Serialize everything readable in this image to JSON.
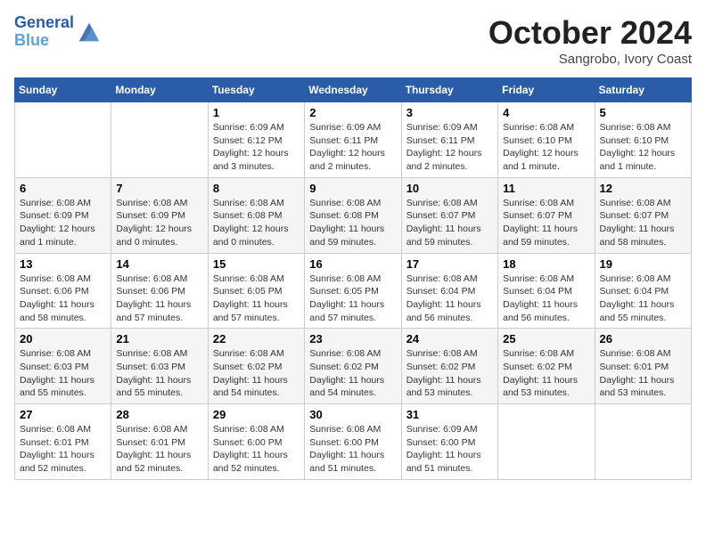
{
  "header": {
    "logo_line1": "General",
    "logo_line2": "Blue",
    "month": "October 2024",
    "location": "Sangrobo, Ivory Coast"
  },
  "weekdays": [
    "Sunday",
    "Monday",
    "Tuesday",
    "Wednesday",
    "Thursday",
    "Friday",
    "Saturday"
  ],
  "weeks": [
    [
      {
        "day": "",
        "info": ""
      },
      {
        "day": "",
        "info": ""
      },
      {
        "day": "1",
        "info": "Sunrise: 6:09 AM\nSunset: 6:12 PM\nDaylight: 12 hours and 3 minutes."
      },
      {
        "day": "2",
        "info": "Sunrise: 6:09 AM\nSunset: 6:11 PM\nDaylight: 12 hours and 2 minutes."
      },
      {
        "day": "3",
        "info": "Sunrise: 6:09 AM\nSunset: 6:11 PM\nDaylight: 12 hours and 2 minutes."
      },
      {
        "day": "4",
        "info": "Sunrise: 6:08 AM\nSunset: 6:10 PM\nDaylight: 12 hours and 1 minute."
      },
      {
        "day": "5",
        "info": "Sunrise: 6:08 AM\nSunset: 6:10 PM\nDaylight: 12 hours and 1 minute."
      }
    ],
    [
      {
        "day": "6",
        "info": "Sunrise: 6:08 AM\nSunset: 6:09 PM\nDaylight: 12 hours and 1 minute."
      },
      {
        "day": "7",
        "info": "Sunrise: 6:08 AM\nSunset: 6:09 PM\nDaylight: 12 hours and 0 minutes."
      },
      {
        "day": "8",
        "info": "Sunrise: 6:08 AM\nSunset: 6:08 PM\nDaylight: 12 hours and 0 minutes."
      },
      {
        "day": "9",
        "info": "Sunrise: 6:08 AM\nSunset: 6:08 PM\nDaylight: 11 hours and 59 minutes."
      },
      {
        "day": "10",
        "info": "Sunrise: 6:08 AM\nSunset: 6:07 PM\nDaylight: 11 hours and 59 minutes."
      },
      {
        "day": "11",
        "info": "Sunrise: 6:08 AM\nSunset: 6:07 PM\nDaylight: 11 hours and 59 minutes."
      },
      {
        "day": "12",
        "info": "Sunrise: 6:08 AM\nSunset: 6:07 PM\nDaylight: 11 hours and 58 minutes."
      }
    ],
    [
      {
        "day": "13",
        "info": "Sunrise: 6:08 AM\nSunset: 6:06 PM\nDaylight: 11 hours and 58 minutes."
      },
      {
        "day": "14",
        "info": "Sunrise: 6:08 AM\nSunset: 6:06 PM\nDaylight: 11 hours and 57 minutes."
      },
      {
        "day": "15",
        "info": "Sunrise: 6:08 AM\nSunset: 6:05 PM\nDaylight: 11 hours and 57 minutes."
      },
      {
        "day": "16",
        "info": "Sunrise: 6:08 AM\nSunset: 6:05 PM\nDaylight: 11 hours and 57 minutes."
      },
      {
        "day": "17",
        "info": "Sunrise: 6:08 AM\nSunset: 6:04 PM\nDaylight: 11 hours and 56 minutes."
      },
      {
        "day": "18",
        "info": "Sunrise: 6:08 AM\nSunset: 6:04 PM\nDaylight: 11 hours and 56 minutes."
      },
      {
        "day": "19",
        "info": "Sunrise: 6:08 AM\nSunset: 6:04 PM\nDaylight: 11 hours and 55 minutes."
      }
    ],
    [
      {
        "day": "20",
        "info": "Sunrise: 6:08 AM\nSunset: 6:03 PM\nDaylight: 11 hours and 55 minutes."
      },
      {
        "day": "21",
        "info": "Sunrise: 6:08 AM\nSunset: 6:03 PM\nDaylight: 11 hours and 55 minutes."
      },
      {
        "day": "22",
        "info": "Sunrise: 6:08 AM\nSunset: 6:02 PM\nDaylight: 11 hours and 54 minutes."
      },
      {
        "day": "23",
        "info": "Sunrise: 6:08 AM\nSunset: 6:02 PM\nDaylight: 11 hours and 54 minutes."
      },
      {
        "day": "24",
        "info": "Sunrise: 6:08 AM\nSunset: 6:02 PM\nDaylight: 11 hours and 53 minutes."
      },
      {
        "day": "25",
        "info": "Sunrise: 6:08 AM\nSunset: 6:02 PM\nDaylight: 11 hours and 53 minutes."
      },
      {
        "day": "26",
        "info": "Sunrise: 6:08 AM\nSunset: 6:01 PM\nDaylight: 11 hours and 53 minutes."
      }
    ],
    [
      {
        "day": "27",
        "info": "Sunrise: 6:08 AM\nSunset: 6:01 PM\nDaylight: 11 hours and 52 minutes."
      },
      {
        "day": "28",
        "info": "Sunrise: 6:08 AM\nSunset: 6:01 PM\nDaylight: 11 hours and 52 minutes."
      },
      {
        "day": "29",
        "info": "Sunrise: 6:08 AM\nSunset: 6:00 PM\nDaylight: 11 hours and 52 minutes."
      },
      {
        "day": "30",
        "info": "Sunrise: 6:08 AM\nSunset: 6:00 PM\nDaylight: 11 hours and 51 minutes."
      },
      {
        "day": "31",
        "info": "Sunrise: 6:09 AM\nSunset: 6:00 PM\nDaylight: 11 hours and 51 minutes."
      },
      {
        "day": "",
        "info": ""
      },
      {
        "day": "",
        "info": ""
      }
    ]
  ]
}
